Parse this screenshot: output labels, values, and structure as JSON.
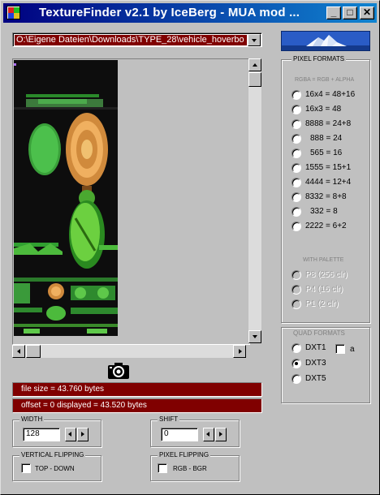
{
  "window": {
    "title": "TextureFinder v2.1 by IceBerg - MUA mod ...",
    "controls": {
      "minimize": "_",
      "maximize": "□",
      "close": "✕"
    }
  },
  "file_path": "O:\\Eigene Dateien\\Downloads\\TYPE_28\\vehicle_hoverbo",
  "info": {
    "file_size": "file size = 43.760 bytes",
    "offset_displayed": "offset = 0   displayed = 43.520 bytes"
  },
  "pixel_formats": {
    "title": "PIXEL FORMATS",
    "subtitle": "RGBA = RGB + ALPHA",
    "options": [
      {
        "label": "16x4 = 48+16",
        "checked": false
      },
      {
        "label": "16x3 = 48",
        "checked": false
      },
      {
        "label": "8888 = 24+8",
        "checked": false
      },
      {
        "label": "888 = 24",
        "checked": false
      },
      {
        "label": "565 = 16",
        "checked": false
      },
      {
        "label": "1555 = 15+1",
        "checked": false
      },
      {
        "label": "4444 = 12+4",
        "checked": false
      },
      {
        "label": "8332 = 8+8",
        "checked": false
      },
      {
        "label": "332 = 8",
        "checked": false
      },
      {
        "label": "2222 = 6+2",
        "checked": false
      }
    ],
    "palette_title": "WITH PALETTE",
    "palette_options": [
      {
        "label": "P8  (256 clr)",
        "disabled": true
      },
      {
        "label": "P4  (16 clr)",
        "disabled": true
      },
      {
        "label": "P1  (2 clr)",
        "disabled": true
      }
    ]
  },
  "quad_formats": {
    "title": "QUAD FORMATS",
    "options": [
      {
        "label": "DXT1",
        "checked": false
      },
      {
        "label": "DXT3",
        "checked": true
      },
      {
        "label": "DXT5",
        "checked": false
      }
    ],
    "alpha_label": "a"
  },
  "width": {
    "title": "WIDTH",
    "value": "128"
  },
  "shift": {
    "title": "SHIFT",
    "value": "0"
  },
  "vertical_flipping": {
    "title": "VERTICAL FLIPPING",
    "label": "TOP - DOWN"
  },
  "pixel_flipping": {
    "title": "PIXEL FLIPPING",
    "label": "RGB  -  BGR"
  },
  "colors": {
    "info_bar": "#800000",
    "title_start": "#000080",
    "title_end": "#1084d0"
  }
}
